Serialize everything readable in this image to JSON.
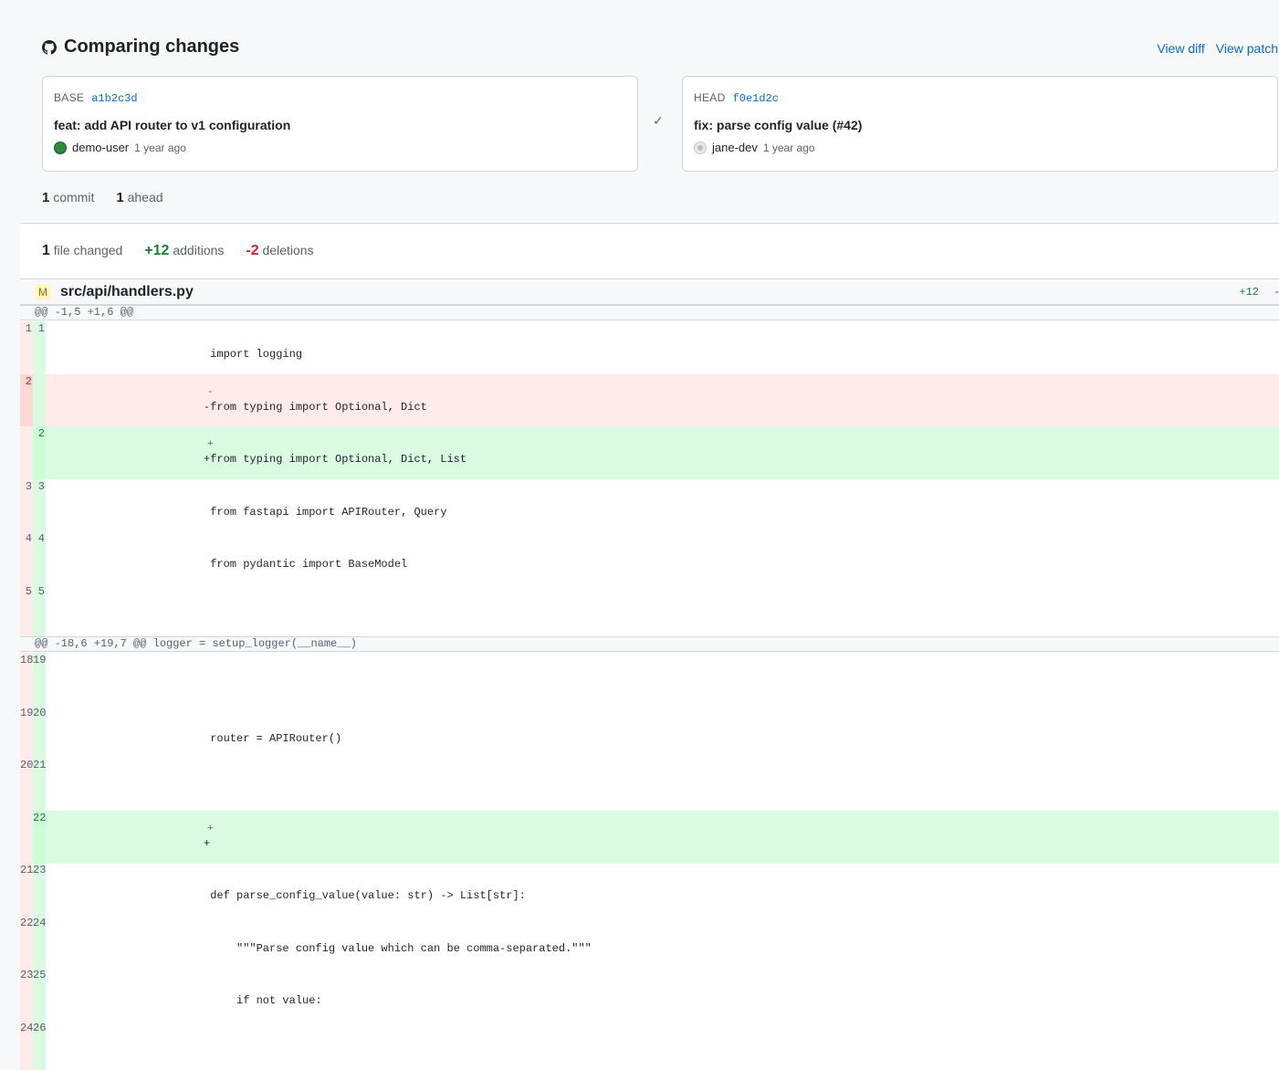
{
  "header": {
    "title": "Comparing changes",
    "view_diff": "View diff",
    "view_patch": "View patch"
  },
  "base": {
    "label": "BASE",
    "sha": "a1b2c3d",
    "message": "feat: add API router to v1 configuration",
    "author": "demo-user",
    "time": "1 year ago"
  },
  "head": {
    "label": "HEAD",
    "sha": "f0e1d2c",
    "message": "fix: parse config value (#42)",
    "author": "jane-dev",
    "time": "1 year ago"
  },
  "commit_stats": {
    "commits_count": "1",
    "commits_label": "commit",
    "ahead_count": "1",
    "ahead_label": "ahead"
  },
  "diff_summary": {
    "files_count": "1",
    "files_label": "file changed",
    "additions_count": "+12",
    "additions_label": "additions",
    "deletions_count": "-2",
    "deletions_label": "deletions"
  },
  "file": {
    "status": "M",
    "path": "src/api/handlers.py",
    "additions": "+12",
    "deletions": "-"
  },
  "hunks": [
    {
      "header": "@@ -1,5 +1,6 @@",
      "lines": [
        {
          "old": "1",
          "new": "1",
          "type": "ctx",
          "marker": "",
          "code": " import logging"
        },
        {
          "old": "2",
          "new": "",
          "type": "del",
          "marker": "-",
          "code": "-from typing import Optional, Dict"
        },
        {
          "old": "",
          "new": "2",
          "type": "add",
          "marker": "+",
          "code": "+from typing import Optional, Dict, List"
        },
        {
          "old": "3",
          "new": "3",
          "type": "ctx",
          "marker": "",
          "code": " from fastapi import APIRouter, Query"
        },
        {
          "old": "4",
          "new": "4",
          "type": "ctx",
          "marker": "",
          "code": " from pydantic import BaseModel"
        },
        {
          "old": "5",
          "new": "5",
          "type": "ctx",
          "marker": "",
          "code": ""
        }
      ]
    },
    {
      "header": "@@ -18,6 +19,7 @@ logger = setup_logger(__name__)",
      "lines": [
        {
          "old": "18",
          "new": "19",
          "type": "ctx",
          "marker": "",
          "code": ""
        },
        {
          "old": "19",
          "new": "20",
          "type": "ctx",
          "marker": "",
          "code": " router = APIRouter()"
        },
        {
          "old": "20",
          "new": "21",
          "type": "ctx",
          "marker": "",
          "code": ""
        },
        {
          "old": "",
          "new": "22",
          "type": "add",
          "marker": "+",
          "code": "+"
        },
        {
          "old": "21",
          "new": "23",
          "type": "ctx",
          "marker": "",
          "code": " def parse_config_value(value: str) -> List[str]:"
        },
        {
          "old": "22",
          "new": "24",
          "type": "ctx",
          "marker": "",
          "code": "     \"\"\"Parse config value which can be comma-separated.\"\"\""
        },
        {
          "old": "23",
          "new": "25",
          "type": "ctx",
          "marker": "",
          "code": "     if not value:"
        },
        {
          "old": "24",
          "new": "26",
          "type": "ctx",
          "marker": "",
          "code": ""
        }
      ]
    }
  ]
}
